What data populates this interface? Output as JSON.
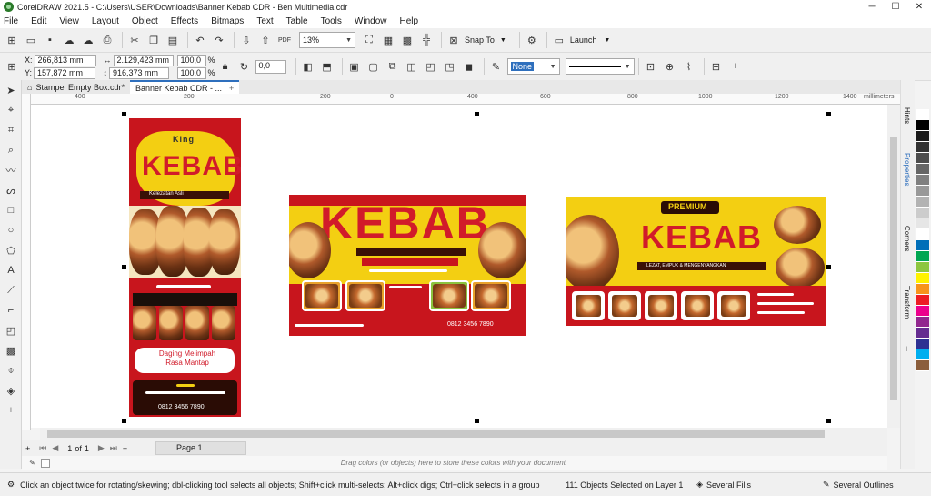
{
  "window": {
    "title": "CorelDRAW 2021.5 - C:\\Users\\USER\\Downloads\\Banner Kebab CDR - Ben Multimedia.cdr",
    "minimize": "─",
    "restore": "☐",
    "close": "✕"
  },
  "menu": [
    "File",
    "Edit",
    "View",
    "Layout",
    "Object",
    "Effects",
    "Bitmaps",
    "Text",
    "Table",
    "Tools",
    "Window",
    "Help"
  ],
  "toolbar1": {
    "zoom": "13%",
    "snap_to": "Snap To",
    "launch": "Launch",
    "pdf": "PDF"
  },
  "toolbar2": {
    "x_label": "X:",
    "x": "266,813 mm",
    "y_label": "Y:",
    "y": "157,872 mm",
    "width": "2.129,423 mm",
    "height": "916,373 mm",
    "scale_w": "100,0",
    "scale_h": "100,0",
    "pct": "%",
    "rotation": "0,0",
    "outline": "None"
  },
  "tabs": [
    {
      "label": "Stampel Empty Box.cdr*"
    },
    {
      "label": "Banner Kebab CDR - ..."
    }
  ],
  "ruler": {
    "unit": "millimeters",
    "ticks": [
      "400",
      "200",
      "0",
      "200",
      "400",
      "600",
      "800",
      "1000",
      "1200",
      "1400"
    ]
  },
  "design": {
    "kebab_text": "KEBAB",
    "kicker_top": "King",
    "tagline_1": "Kelezatan Asli",
    "premium": "PREMIUM",
    "promo": "Daging Melimpah Rasa Mantap",
    "phone": "0812 3456 7890",
    "tagline_3": "LEZAT, EMPUK & MENGENYANGKAN"
  },
  "dockers": {
    "hints": "Hints",
    "properties": "Properties",
    "corners": "Corners",
    "transform": "Transform"
  },
  "page_nav": {
    "current": "1",
    "of": "of",
    "total": "1",
    "page_tab": "Page 1"
  },
  "colorwell_text": "Drag colors (or objects) here to store these colors with your document",
  "status": {
    "hint": "Click an object twice for rotating/skewing; dbl-clicking tool selects all objects; Shift+click multi-selects; Alt+click digs; Ctrl+click selects in a group",
    "selection": "111 Objects Selected on Layer 1",
    "fill": "Several Fills",
    "outline": "Several Outlines"
  },
  "palette": [
    "#ffffff",
    "#000000",
    "#1a1a1a",
    "#333333",
    "#4d4d4d",
    "#666666",
    "#808080",
    "#999999",
    "#b3b3b3",
    "#cccccc",
    "#e6e6e6",
    "#ffffff",
    "#006eb8",
    "#00a651",
    "#8dc63f",
    "#fff200",
    "#f7941d",
    "#ed1c24",
    "#ec008c",
    "#92278f",
    "#662d91",
    "#2e3192",
    "#00aeef",
    "#8b5e3c"
  ],
  "colors": {
    "accent": "#d11b2a",
    "banner_yellow": "#f3cf12",
    "selection_blue": "#2e6fbd"
  }
}
